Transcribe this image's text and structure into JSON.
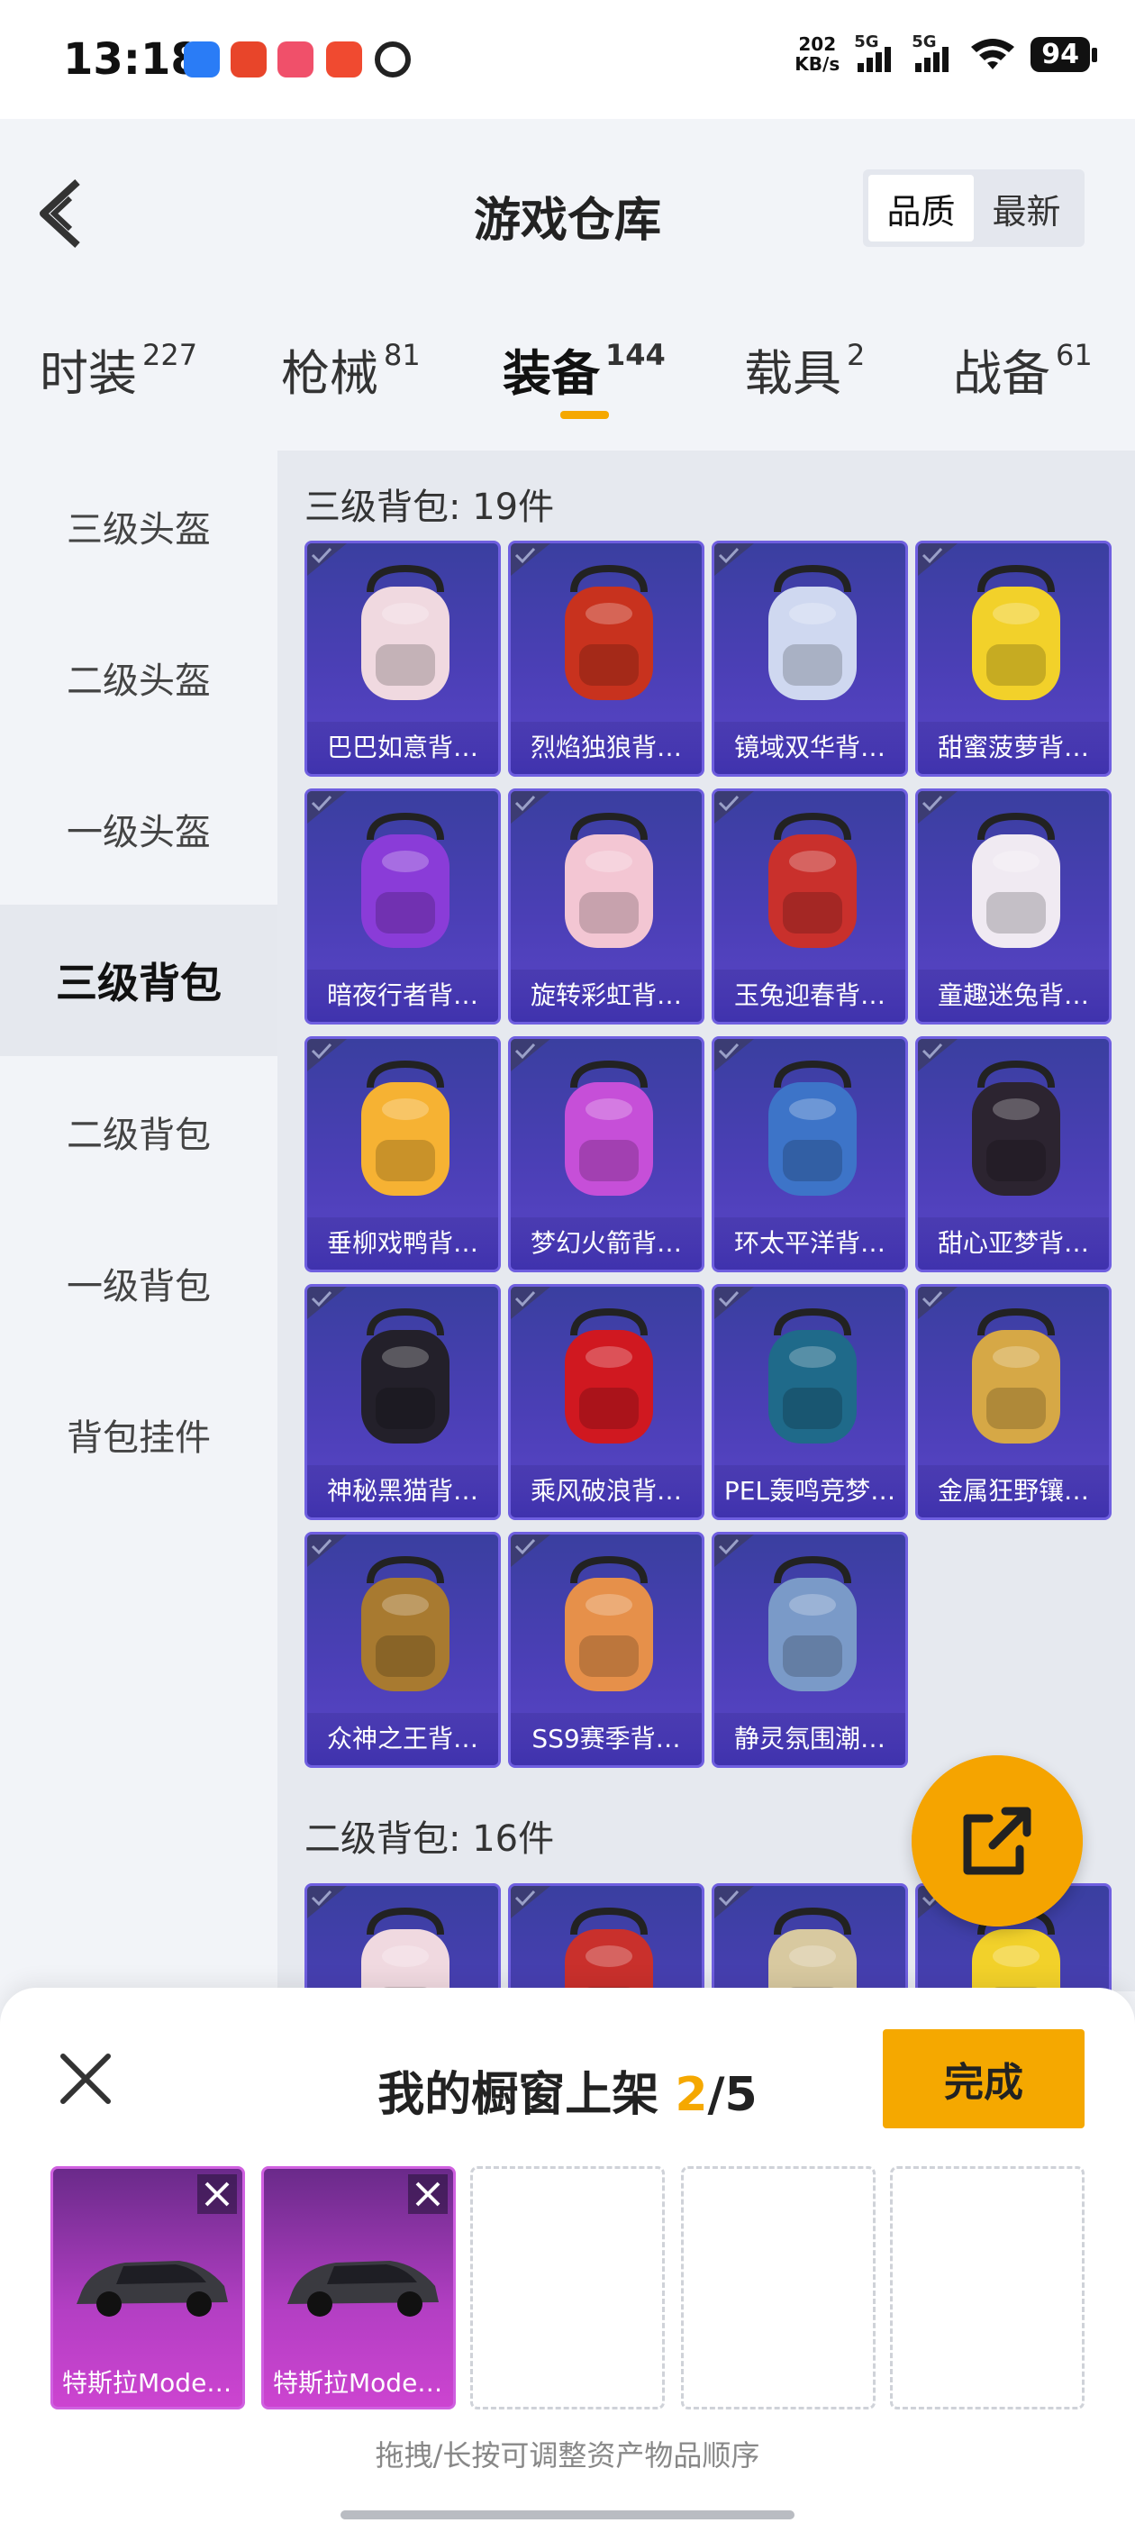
{
  "status_bar": {
    "time": "13:18",
    "net_speed_value": "202",
    "net_speed_unit": "KB/s",
    "sim1": "5G",
    "sim2": "5G",
    "battery": "94"
  },
  "header": {
    "title": "游戏仓库",
    "sort_options": [
      "品质",
      "最新"
    ],
    "sort_selected": "品质"
  },
  "tabs": [
    {
      "label": "时装",
      "count": "227"
    },
    {
      "label": "枪械",
      "count": "81"
    },
    {
      "label": "装备",
      "count": "144"
    },
    {
      "label": "载具",
      "count": "2"
    },
    {
      "label": "战备",
      "count": "61"
    }
  ],
  "active_tab": "装备",
  "sidebar": {
    "items": [
      "三级头盔",
      "二级头盔",
      "一级头盔",
      "三级背包",
      "二级背包",
      "一级背包",
      "背包挂件"
    ],
    "active": "三级背包"
  },
  "sections": [
    {
      "title": "三级背包: 19件",
      "items": [
        {
          "name": "巴巴如意背…",
          "color": "#f0d9e0"
        },
        {
          "name": "烈焰独狼背…",
          "color": "#c8321e"
        },
        {
          "name": "镜域双华背…",
          "color": "#cfd8f0"
        },
        {
          "name": "甜蜜菠萝背…",
          "color": "#f2d12a"
        },
        {
          "name": "暗夜行者背…",
          "color": "#8a3cd8"
        },
        {
          "name": "旋转彩虹背…",
          "color": "#f3c6d3"
        },
        {
          "name": "玉兔迎春背…",
          "color": "#c9302c"
        },
        {
          "name": "童趣迷兔背…",
          "color": "#f0eaf2"
        },
        {
          "name": "垂柳戏鸭背…",
          "color": "#f6b233"
        },
        {
          "name": "梦幻火箭背…",
          "color": "#c64fd8"
        },
        {
          "name": "环太平洋背…",
          "color": "#3d74c8"
        },
        {
          "name": "甜心亚梦背…",
          "color": "#2c2430"
        },
        {
          "name": "神秘黑猫背…",
          "color": "#23202a"
        },
        {
          "name": "乘风破浪背…",
          "color": "#d01820"
        },
        {
          "name": "PEL轰鸣竞梦…",
          "color": "#1f6a8a"
        },
        {
          "name": "金属狂野镶…",
          "color": "#d6a846"
        },
        {
          "name": "众神之王背…",
          "color": "#a87a30"
        },
        {
          "name": "SS9赛季背…",
          "color": "#e6904a"
        },
        {
          "name": "静灵氛围潮…",
          "color": "#7a9ac8"
        }
      ]
    },
    {
      "title": "二级背包: 16件",
      "items": [
        {
          "name": "",
          "color": "#f0d9e0"
        },
        {
          "name": "",
          "color": "#c9302c"
        },
        {
          "name": "",
          "color": "#d8c9a0"
        },
        {
          "name": "",
          "color": "#f2d12a"
        }
      ]
    }
  ],
  "showcase": {
    "title_prefix": "我的橱窗上架 ",
    "count": "2",
    "total": "/5",
    "done_label": "完成",
    "items": [
      {
        "name": "特斯拉Mode…"
      },
      {
        "name": "特斯拉Mode…"
      }
    ],
    "empty_slots": 3,
    "hint": "拖拽/长按可调整资产物品顺序"
  },
  "colors": {
    "accent": "#f5a800",
    "item_card": "#4b3fb6",
    "showcase_card": "#b43fc4"
  },
  "icons": [
    "back-icon",
    "share-icon",
    "close-icon",
    "check-icon",
    "wifi-icon",
    "signal-icon"
  ]
}
